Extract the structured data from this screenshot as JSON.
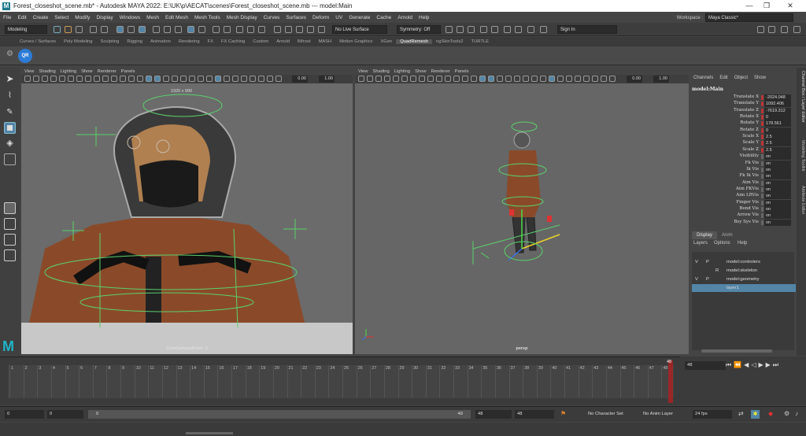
{
  "title": {
    "app_title": "Forest_closeshot_scene.mb* - Autodesk MAYA 2022: E:\\UK\\p\\AECAT\\scenes\\Forest_closeshot_scene.mb   ---   model:Main",
    "minimize": "—",
    "maximize": "❐",
    "close": "✕"
  },
  "menu": [
    "File",
    "Edit",
    "Create",
    "Select",
    "Modify",
    "Display",
    "Windows",
    "Mesh",
    "Edit Mesh",
    "Mesh Tools",
    "Mesh Display",
    "Curves",
    "Surfaces",
    "Deform",
    "UV",
    "Generate",
    "Cache",
    "Arnold",
    "Help"
  ],
  "workspace": {
    "label": "Workspace :",
    "value": "Maya Classic*"
  },
  "status": {
    "mode": "Modeling",
    "live_surface": "No Live Surface",
    "symmetry": "Symmetry: Off",
    "sign_in": "Sign In"
  },
  "shelf_tabs": [
    "Curves / Surfaces",
    "Poly Modeling",
    "Sculpting",
    "Rigging",
    "Animation",
    "Rendering",
    "FX",
    "FX Caching",
    "Custom",
    "Arnold",
    "Bifrost",
    "MASH",
    "Motion Graphics",
    "XGen",
    "QuadRemesh",
    "ngSkinTools2",
    "TURTLE"
  ],
  "shelf_active": "QuadRemesh",
  "shelf_icon": "QR",
  "viewport_menu": [
    "View",
    "Shading",
    "Lighting",
    "Show",
    "Renderer",
    "Panels"
  ],
  "vp1": {
    "near": "0.00",
    "far": "1.00",
    "resolution": "1920 x 990",
    "camera": "CineCameraActor_3"
  },
  "vp2": {
    "near": "0.00",
    "far": "1.00",
    "camera": "persp"
  },
  "channel_box": {
    "tabs": [
      "Channels",
      "Edit",
      "Object",
      "Show"
    ],
    "object": "model:Main",
    "attrs": [
      {
        "name": "Translate X",
        "value": "-2024.048"
      },
      {
        "name": "Translate Y",
        "value": "1092.406"
      },
      {
        "name": "Translate Z",
        "value": "-7619.312"
      },
      {
        "name": "Rotate X",
        "value": "0"
      },
      {
        "name": "Rotate Y",
        "value": "178.561"
      },
      {
        "name": "Rotate Z",
        "value": "0"
      },
      {
        "name": "Scale X",
        "value": "2.5"
      },
      {
        "name": "Scale Y",
        "value": "2.5"
      },
      {
        "name": "Scale Z",
        "value": "2.5"
      },
      {
        "name": "Visibility",
        "value": "on"
      },
      {
        "name": "Fk Vis",
        "value": "on"
      },
      {
        "name": "Ik Vis",
        "value": "on"
      },
      {
        "name": "Fk Ik Vis",
        "value": "on"
      },
      {
        "name": "Aim Vis",
        "value": "on"
      },
      {
        "name": "Aim FKVis",
        "value": "on"
      },
      {
        "name": "Aim LRVis",
        "value": "on"
      },
      {
        "name": "Finger Vis",
        "value": "on"
      },
      {
        "name": "Bend Vis",
        "value": "on"
      },
      {
        "name": "Arrow Vis",
        "value": "on"
      },
      {
        "name": "Bsy Sys Vis",
        "value": "on"
      }
    ]
  },
  "layers": {
    "tabs": [
      "Display",
      "Anim"
    ],
    "menu": [
      "Layers",
      "Options",
      "Help"
    ],
    "rows": [
      {
        "v": "V",
        "p": "P",
        "name": "model:controlers"
      },
      {
        "v": "",
        "p": "R",
        "name": "model:skeleton"
      },
      {
        "v": "V",
        "p": "P",
        "name": "model:geometry"
      },
      {
        "v": "",
        "p": "",
        "name": "layer1"
      }
    ]
  },
  "side_tabs": [
    "Channel Box / Layer Editor",
    "Modeling Toolkit",
    "Attribute Editor"
  ],
  "timeline": {
    "ticks": [
      "1",
      "2",
      "3",
      "4",
      "5",
      "6",
      "7",
      "8",
      "9",
      "10",
      "11",
      "12",
      "13",
      "14",
      "15",
      "16",
      "17",
      "18",
      "19",
      "20",
      "21",
      "22",
      "23",
      "24",
      "25",
      "26",
      "27",
      "28",
      "29",
      "30",
      "31",
      "32",
      "33",
      "34",
      "35",
      "36",
      "37",
      "38",
      "39",
      "40",
      "41",
      "42",
      "43",
      "44",
      "45",
      "46",
      "47",
      "48"
    ],
    "current": "48",
    "current_end": "48"
  },
  "range": {
    "start": "0",
    "start2": "0",
    "slider_start": "0",
    "slider_end": "48",
    "end": "48",
    "end2": "48",
    "character_set": "No Character Set",
    "anim_layer": "No Anim Layer",
    "fps": "24 fps"
  },
  "colors": {
    "accent": "#5285a6",
    "red": "#c73a3a",
    "timeline_cursor": "#b02020"
  }
}
